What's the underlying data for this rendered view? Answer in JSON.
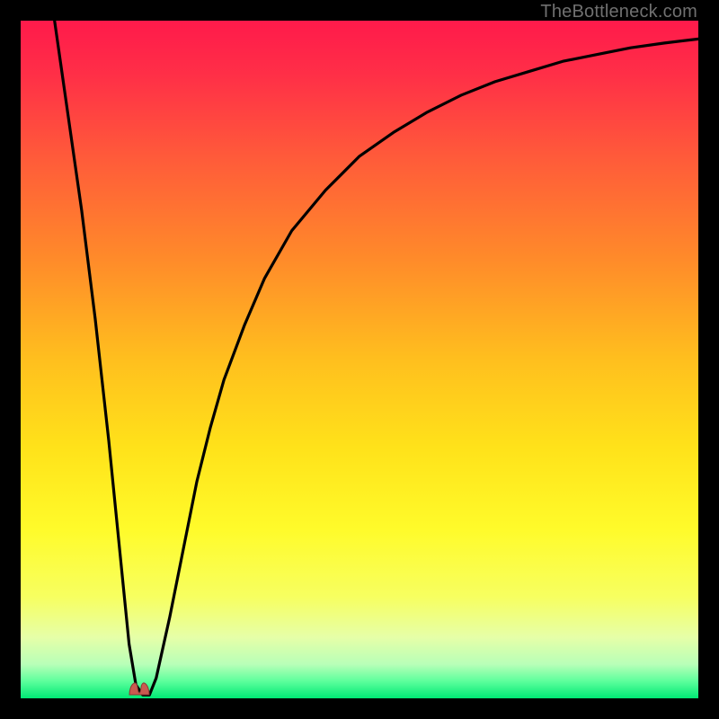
{
  "watermark": "TheBottleneck.com",
  "chart_data": {
    "type": "line",
    "title": "",
    "xlabel": "",
    "ylabel": "",
    "xlim": [
      0,
      100
    ],
    "ylim": [
      0,
      100
    ],
    "background_gradient_stops": [
      {
        "pct": 0.0,
        "color": "#ff1a4b"
      },
      {
        "pct": 8.0,
        "color": "#ff2f47"
      },
      {
        "pct": 20.0,
        "color": "#ff5a3a"
      },
      {
        "pct": 35.0,
        "color": "#ff8a2a"
      },
      {
        "pct": 50.0,
        "color": "#ffbf1e"
      },
      {
        "pct": 63.0,
        "color": "#ffe21a"
      },
      {
        "pct": 75.0,
        "color": "#fffb2a"
      },
      {
        "pct": 85.0,
        "color": "#f7ff60"
      },
      {
        "pct": 91.0,
        "color": "#e6ffa8"
      },
      {
        "pct": 95.0,
        "color": "#b8ffb8"
      },
      {
        "pct": 97.5,
        "color": "#5cff9c"
      },
      {
        "pct": 100.0,
        "color": "#00e874"
      }
    ],
    "series": [
      {
        "name": "bottleneck-curve",
        "x": [
          5,
          6,
          7,
          8,
          9,
          10,
          11,
          12,
          13,
          14,
          15,
          16,
          17,
          18,
          19,
          20,
          22,
          24,
          26,
          28,
          30,
          33,
          36,
          40,
          45,
          50,
          55,
          60,
          65,
          70,
          75,
          80,
          85,
          90,
          95,
          100
        ],
        "y": [
          100,
          93,
          86,
          79,
          72,
          64,
          56,
          47,
          38,
          28,
          18,
          8,
          2,
          0.5,
          0.5,
          3,
          12,
          22,
          32,
          40,
          47,
          55,
          62,
          69,
          75,
          80,
          83.5,
          86.5,
          89,
          91,
          92.5,
          94,
          95,
          96,
          96.7,
          97.3
        ]
      }
    ],
    "marker": {
      "name": "optimal-point",
      "x": 17.5,
      "y": 0.5,
      "color": "#c95a50"
    }
  }
}
